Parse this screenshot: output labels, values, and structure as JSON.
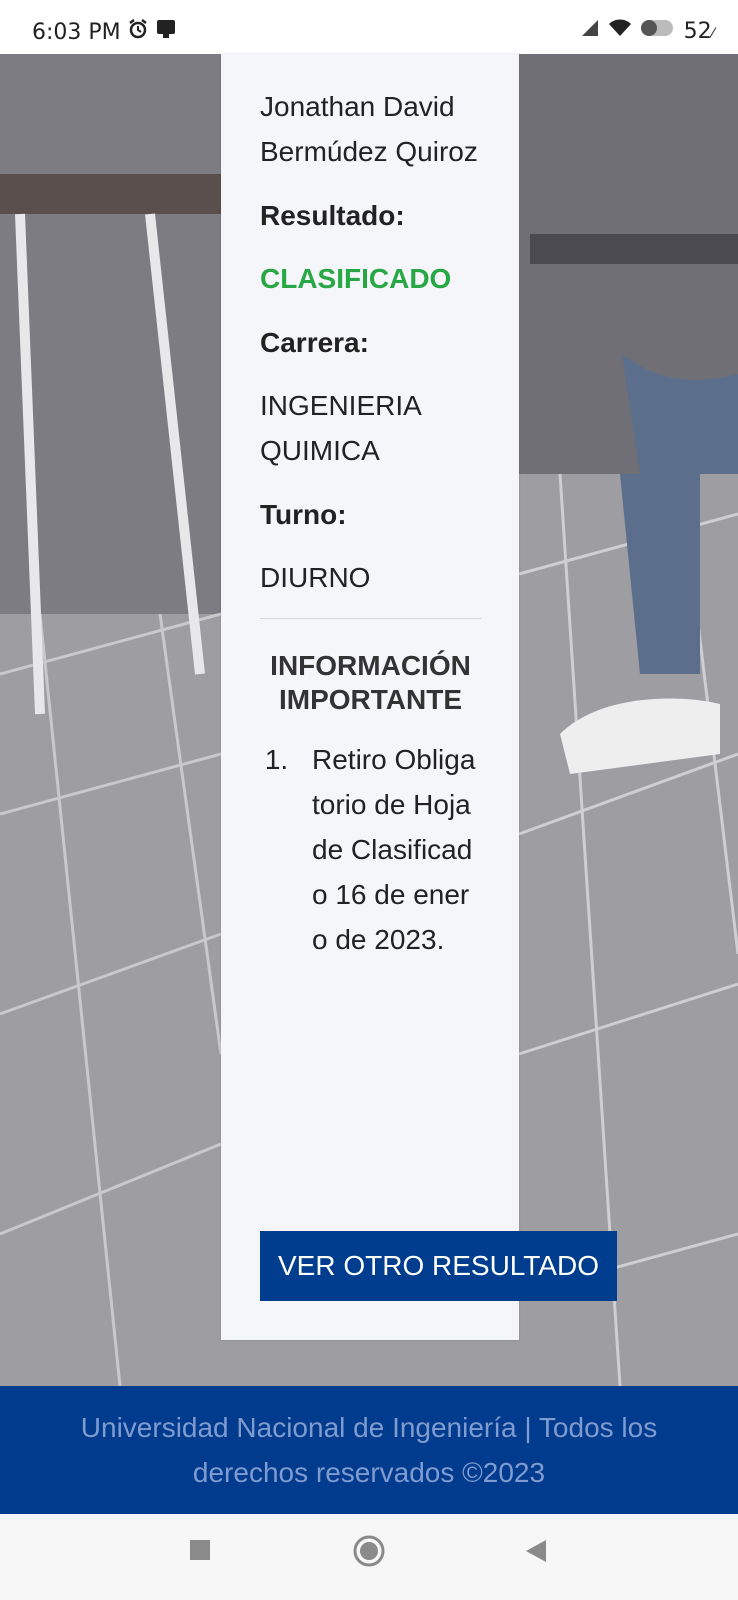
{
  "status_bar": {
    "time": "6:03 PM",
    "battery": "52"
  },
  "result": {
    "name": "Jonathan David Bermúdez Quiroz",
    "result_label": "Resultado:",
    "result_value": "CLASIFICADO",
    "career_label": "Carrera:",
    "career_value": "INGENIERIA QUIMICA",
    "shift_label": "Turno:",
    "shift_value": "DIURNO"
  },
  "info": {
    "title": "INFORMACIÓN IMPORTANTE",
    "items": [
      {
        "text": "Retiro Obligatorio de Hoja de Clasificado 16 de enero de 2023."
      }
    ]
  },
  "button": {
    "label": "VER OTRO RESULTADO"
  },
  "footer": {
    "text": "Universidad Nacional de Ingeniería | Todos los derechos reservados ©2023"
  },
  "colors": {
    "accent": "#003d8f",
    "success": "#28a745"
  }
}
